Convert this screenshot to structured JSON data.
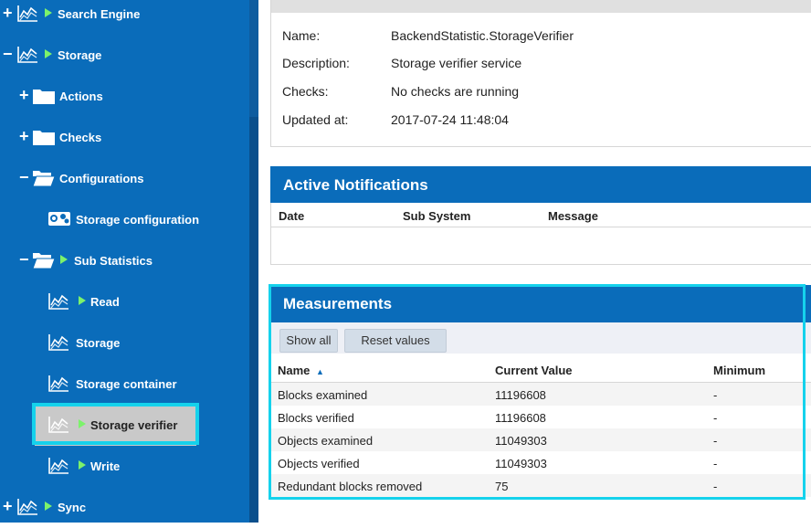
{
  "sidebar": {
    "items": [
      {
        "label": "Search Engine",
        "expander": "+",
        "icon": "chart-icon"
      },
      {
        "label": "Storage",
        "expander": "−",
        "icon": "chart-icon"
      },
      {
        "label": "Actions",
        "expander": "+",
        "icon": "folder-icon"
      },
      {
        "label": "Checks",
        "expander": "+",
        "icon": "folder-icon"
      },
      {
        "label": "Configurations",
        "expander": "−",
        "icon": "folder-open-icon"
      },
      {
        "label": "Storage configuration",
        "expander": "",
        "icon": "config-icon"
      },
      {
        "label": "Sub Statistics",
        "expander": "−",
        "icon": "folder-open-icon"
      },
      {
        "label": "Read",
        "expander": "",
        "icon": "chart-icon"
      },
      {
        "label": "Storage",
        "expander": "",
        "icon": "chart-icon"
      },
      {
        "label": "Storage container",
        "expander": "",
        "icon": "chart-icon"
      },
      {
        "label": "Storage verifier",
        "expander": "",
        "icon": "chart-icon",
        "selected": true
      },
      {
        "label": "Write",
        "expander": "",
        "icon": "chart-icon"
      },
      {
        "label": "Sync",
        "expander": "+",
        "icon": "chart-icon"
      }
    ]
  },
  "info": {
    "name_key": "Name:",
    "name_val": "BackendStatistic.StorageVerifier",
    "desc_key": "Description:",
    "desc_val": "Storage verifier service",
    "checks_key": "Checks:",
    "checks_val": "No checks are running",
    "updated_key": "Updated at:",
    "updated_val": "2017-07-24 11:48:04"
  },
  "notifications": {
    "title": "Active Notifications",
    "col_date": "Date",
    "col_subsystem": "Sub System",
    "col_message": "Message"
  },
  "measurements": {
    "title": "Measurements",
    "show_all": "Show all",
    "reset_values": "Reset values",
    "col_name": "Name",
    "sort_icon": "▲",
    "col_current": "Current Value",
    "col_minimum": "Minimum",
    "rows": [
      {
        "name": "Blocks examined",
        "current": "11196608",
        "minimum": "-"
      },
      {
        "name": "Blocks verified",
        "current": "11196608",
        "minimum": "-"
      },
      {
        "name": "Objects examined",
        "current": "11049303",
        "minimum": "-"
      },
      {
        "name": "Objects verified",
        "current": "11049303",
        "minimum": "-"
      },
      {
        "name": "Redundant blocks removed",
        "current": "75",
        "minimum": "-"
      }
    ]
  },
  "colors": {
    "accent": "#0a6cba",
    "highlight": "#15d2ec",
    "play": "#7cf26b"
  }
}
